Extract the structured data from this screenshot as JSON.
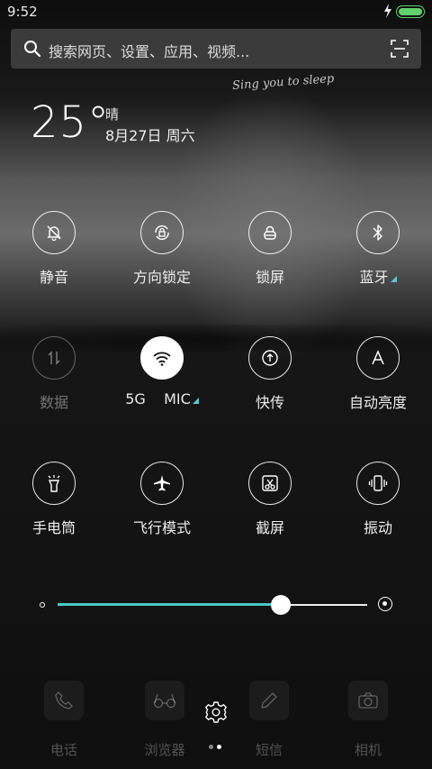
{
  "status": {
    "time": "9:52"
  },
  "search": {
    "placeholder": "搜索网页、设置、应用、视频..."
  },
  "wallpaper": {
    "signature": "Sing you to sleep"
  },
  "weather": {
    "temperature": "25°",
    "condition": "晴",
    "date": "8月27日 周六"
  },
  "toggles_row1": [
    {
      "label": "静音",
      "icon": "bell-off-icon",
      "state": "off"
    },
    {
      "label": "方向锁定",
      "icon": "rotation-lock-icon",
      "state": "off"
    },
    {
      "label": "锁屏",
      "icon": "lock-icon",
      "state": "off"
    },
    {
      "label": "蓝牙",
      "icon": "bluetooth-icon",
      "state": "off",
      "has_more": true
    }
  ],
  "toggles_row2": [
    {
      "label": "数据",
      "icon": "mobile-data-icon",
      "state": "disabled"
    },
    {
      "label": "5G    MIC",
      "icon": "wifi-icon",
      "state": "on",
      "has_more": true
    },
    {
      "label": "快传",
      "icon": "share-transfer-icon",
      "state": "off"
    },
    {
      "label": "自动亮度",
      "icon": "auto-brightness-icon",
      "state": "off"
    }
  ],
  "toggles_row3": [
    {
      "label": "手电筒",
      "icon": "flashlight-icon",
      "state": "off"
    },
    {
      "label": "飞行模式",
      "icon": "airplane-icon",
      "state": "off"
    },
    {
      "label": "截屏",
      "icon": "screenshot-icon",
      "state": "off"
    },
    {
      "label": "振动",
      "icon": "vibrate-icon",
      "state": "off"
    }
  ],
  "brightness": {
    "level": 0.72
  },
  "dock": [
    {
      "label": "电话",
      "icon": "phone-icon"
    },
    {
      "label": "浏览器",
      "icon": "browser-icon"
    },
    {
      "label": "短信",
      "icon": "message-icon"
    },
    {
      "label": "相机",
      "icon": "camera-icon"
    }
  ],
  "colors": {
    "accent": "#49c7c4",
    "battery": "#5fd16e"
  }
}
